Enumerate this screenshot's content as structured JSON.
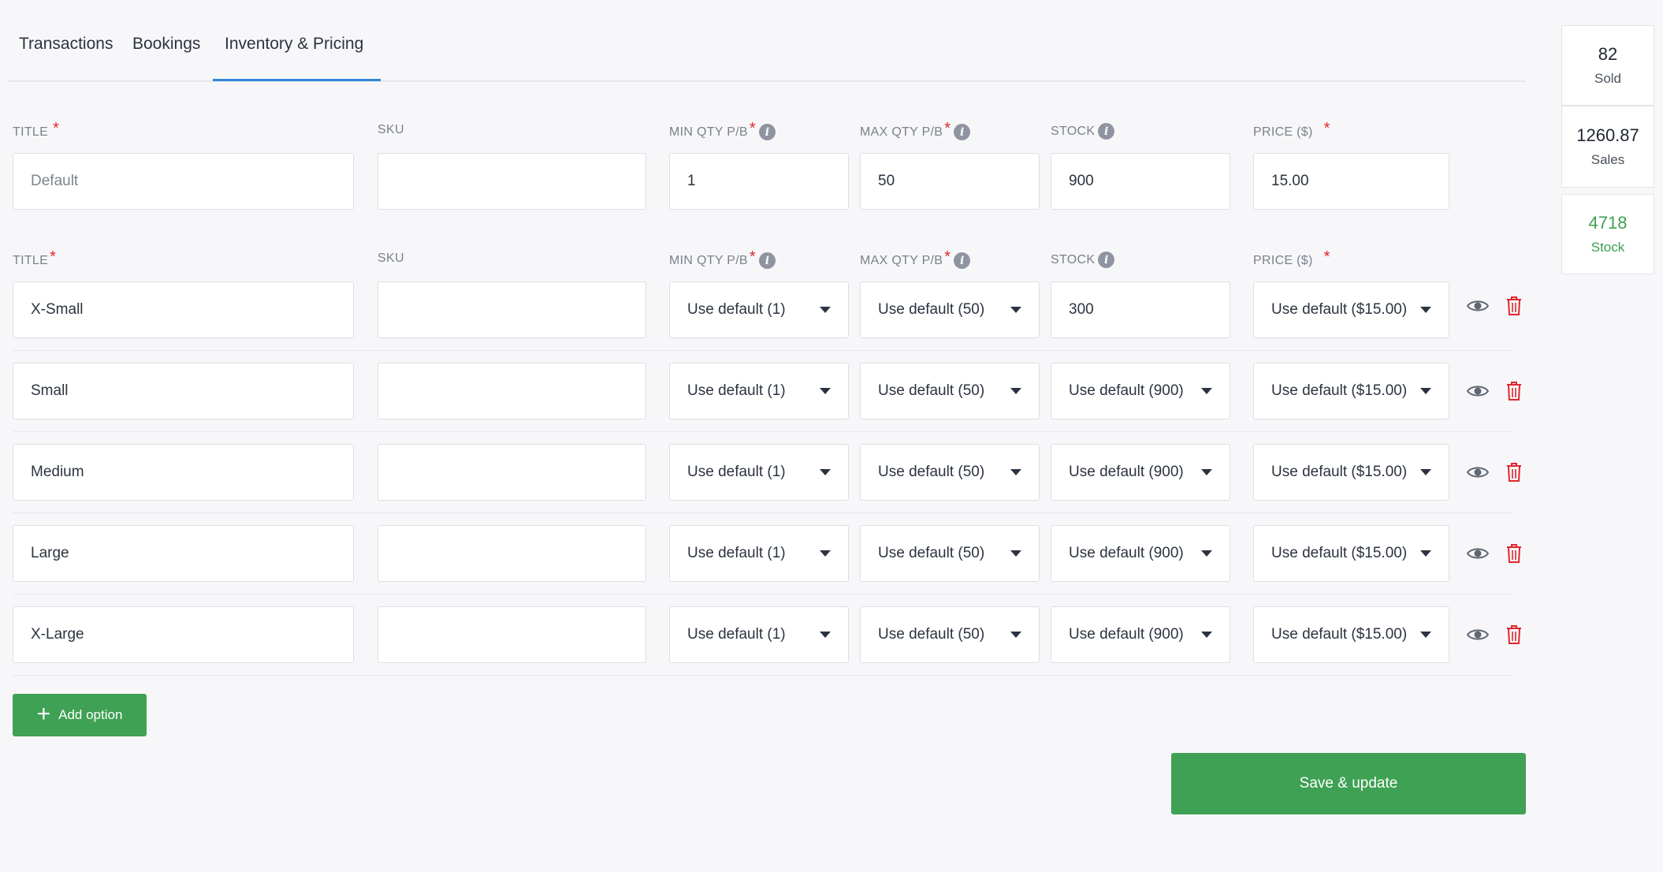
{
  "tabs": [
    "Transactions",
    "Bookings",
    "Inventory & Pricing"
  ],
  "default_headers": {
    "title": "TITLE",
    "sku": "SKU",
    "min_qty": "MIN QTY P/B",
    "max_qty": "MAX QTY P/B",
    "stock": "STOCK",
    "price": "PRICE ($)"
  },
  "defaults": {
    "title_placeholder": "Default",
    "sku": "",
    "min_qty": "1",
    "max_qty": "50",
    "stock": "900",
    "price": "15.00"
  },
  "option_headers": {
    "title": "TITLE",
    "sku": "SKU",
    "min_qty": "MIN QTY P/B",
    "max_qty": "MAX QTY P/B",
    "stock": "STOCK",
    "price": "PRICE ($)"
  },
  "options": [
    {
      "title": "X-Small",
      "sku": "",
      "min": "Use default (1)",
      "max": "Use default (50)",
      "stock": "300",
      "price": "Use default ($15.00)"
    },
    {
      "title": "Small",
      "sku": "",
      "min": "Use default (1)",
      "max": "Use default (50)",
      "stock": "Use default (900)",
      "price": "Use default ($15.00)"
    },
    {
      "title": "Medium",
      "sku": "",
      "min": "Use default (1)",
      "max": "Use default (50)",
      "stock": "Use default (900)",
      "price": "Use default ($15.00)"
    },
    {
      "title": "Large",
      "sku": "",
      "min": "Use default (1)",
      "max": "Use default (50)",
      "stock": "Use default (900)",
      "price": "Use default ($15.00)"
    },
    {
      "title": "X-Large",
      "sku": "",
      "min": "Use default (1)",
      "max": "Use default (50)",
      "stock": "Use default (900)",
      "price": "Use default ($15.00)"
    }
  ],
  "buttons": {
    "add_option": "Add option",
    "save": "Save & update"
  },
  "stats": {
    "sold": {
      "value": "82",
      "label": "Sold"
    },
    "sales": {
      "value": "1260.87",
      "label": "Sales"
    },
    "stock": {
      "value": "4718",
      "label": "Stock"
    }
  },
  "icons": {
    "visibility": "eye-icon",
    "delete": "trash-icon",
    "info": "info-icon",
    "add": "plus-icon",
    "dropdown": "caret-down-icon"
  },
  "colors": {
    "accent_green": "#3ea153",
    "tab_active": "#2f86d6",
    "required": "#e0262f",
    "delete_red": "#e0262f"
  }
}
